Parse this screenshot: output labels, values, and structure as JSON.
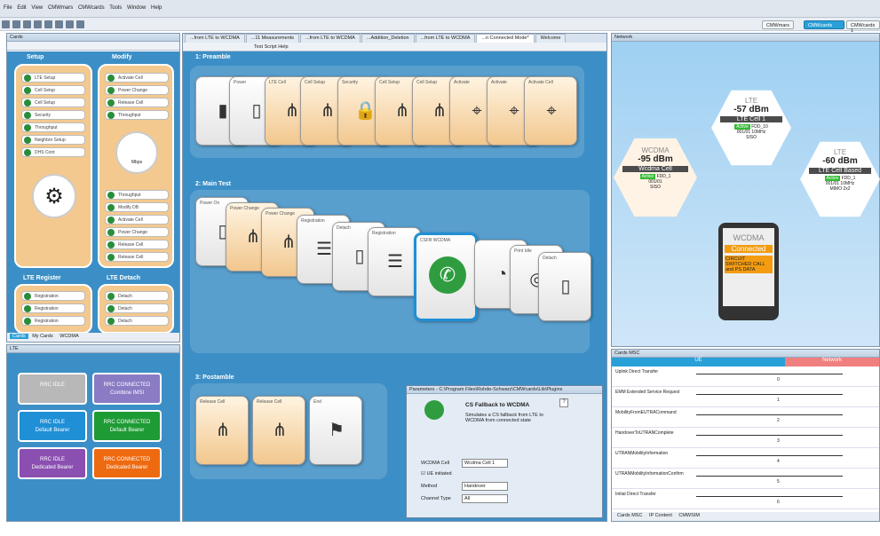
{
  "menu": {
    "items": [
      "File",
      "Edit",
      "View",
      "CMWmars",
      "CMWcards",
      "Tools",
      "Window",
      "Help"
    ]
  },
  "views": [
    "CMWmars",
    "CMWcards",
    "CMWcards 1"
  ],
  "cards_panel": {
    "title": "Cards",
    "setup": "Setup",
    "modify": "Modify",
    "setup_items": [
      "LTE Setup",
      "Cell Setup",
      "Cell Setup",
      "Security",
      "Throughput",
      "Neighbor Setup",
      "DHS Cont"
    ],
    "modify_items": [
      "Activate Cell",
      "Power Change",
      "Release Cell",
      "Throughput"
    ],
    "modify_lower": [
      "Throughput",
      "Modify DB",
      "Activate Cell",
      "Power Change",
      "Release Cell",
      "Release Cell"
    ],
    "center_label": "Mbps",
    "lte_register": "LTE Register",
    "lte_detach": "LTE Detach",
    "register_items": [
      "Registration",
      "Registration",
      "Registration"
    ],
    "detach_items": [
      "Detach",
      "Detach",
      "Detach"
    ],
    "bottom_tabs": [
      "Cards",
      "My Cards",
      "WCDMA"
    ]
  },
  "lte_panel": {
    "title": "LTE",
    "states": [
      {
        "l1": "RRC IDLE",
        "l2": ""
      },
      {
        "l1": "RRC CONNECTED",
        "l2": "Combine IMSI"
      },
      {
        "l1": "RRC IDLE",
        "l2": "Default Bearer"
      },
      {
        "l1": "RRC CONNECTED",
        "l2": "Default Bearer"
      },
      {
        "l1": "RRC IDLE",
        "l2": "Dedicated Bearer"
      },
      {
        "l1": "RRC CONNECTED",
        "l2": "Dedicated Bearer"
      }
    ],
    "colors": [
      "#b8b8b8",
      "#8a7bc4",
      "#1f8fd6",
      "#1e9b35",
      "#8a4fb0",
      "#ee6a10"
    ]
  },
  "doc_tabs": [
    "...from LTE to WCDMA",
    "...11 Measurements",
    "...from LTE to WCDMA",
    "...Addition_Deletion",
    "...from LTE to WCDMA",
    "...n Connected Mode*",
    "Welcome"
  ],
  "script_toolbar": {
    "help": "Test Script Help"
  },
  "script": {
    "s1": "1: Preamble",
    "s2": "2: Main Test",
    "s3": "3: Postamble",
    "preamble_cards": [
      "",
      "Power",
      "LTE Cell",
      "Cell Setup",
      "Security",
      "Cell Setup",
      "Cell Setup",
      "Activate",
      "Activate",
      "Activate Cell"
    ],
    "main_cards": [
      "Power On",
      "Power Change",
      "Power Change",
      "Registration",
      "Detach",
      "Registration",
      "CSFB WCDMA",
      "",
      "Print Idle",
      "Detach"
    ],
    "post_cards": [
      "Release Cell",
      "Release Cell",
      "End"
    ]
  },
  "params": {
    "title": "Parameters - C:\\Program Files\\Rohde-Schwarz\\CMWcards\\Lib\\Plugins",
    "card_title": "CS Fallback to WCDMA",
    "desc": "Simulates a CS fallback from LTE to WCDMA from connected state",
    "wcdma_cell_label": "WCDMA Cell",
    "wcdma_cell_value": "Wcdma Cell 1",
    "ue_initiated": "UE initiated",
    "method_label": "Method",
    "method_value": "Handover",
    "channel_label": "Channel Type",
    "channel_value": "All"
  },
  "network": {
    "title": "Network",
    "wcdma": {
      "tech": "WCDMA",
      "dbm": "-95 dBm",
      "name": "Wcdma Cell",
      "badge": "Active",
      "fdd": "FDD_1",
      "id": "001/01",
      "mode": "SISO"
    },
    "lte1": {
      "tech": "LTE",
      "dbm": "-57 dBm",
      "name": "LTE Cell 1",
      "badge": "Active",
      "fdd": "FDD_10",
      "id": "001/01",
      "bw": "10MHz",
      "mode": "SISO"
    },
    "lte2": {
      "tech": "LTE",
      "dbm": "-60 dBm",
      "name": "LTE Cell Based",
      "badge": "Active",
      "fdd": "FDD_1",
      "id": "001/01",
      "bw": "10MHz",
      "mode": "MIMO 2x2"
    },
    "phone": {
      "tech": "WCDMA",
      "status": "Connected",
      "info": "CIRCUIT SWITCHED CALL and PS DATA"
    }
  },
  "msc": {
    "title": "Cards MSC",
    "ue": "UE",
    "network": "Network",
    "rows": [
      {
        "name": "Uplink Direct Transfer",
        "num": "0"
      },
      {
        "name": "EMM Extended Service Request",
        "num": "1"
      },
      {
        "name": "MobilityFromEUTRACommand",
        "num": "2"
      },
      {
        "name": "HandoverToUTRANComplete",
        "num": "3"
      },
      {
        "name": "UTRANMobilityInformation",
        "num": "4"
      },
      {
        "name": "UTRANMobilityInformationConfirm",
        "num": "5"
      },
      {
        "name": "Initial Direct Transfer",
        "num": "6"
      }
    ],
    "bottom_tabs": [
      "Cards MSC",
      "IP Content",
      "CMWSIM"
    ]
  }
}
